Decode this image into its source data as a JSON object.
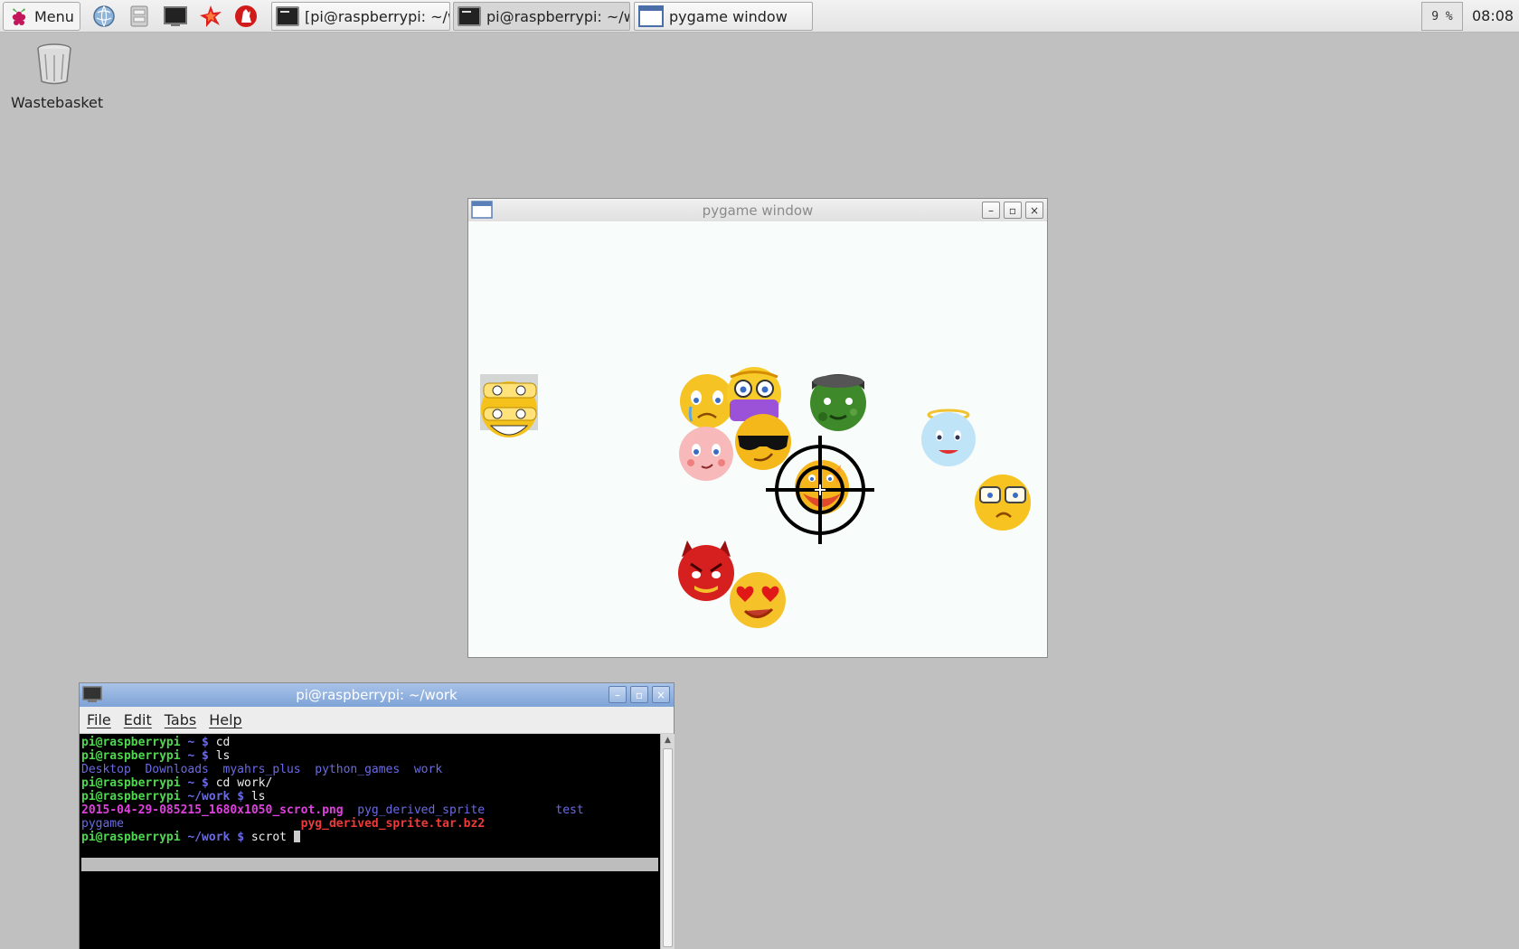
{
  "taskbar": {
    "menu_label": "Menu",
    "launchers": [
      "web-browser-icon",
      "file-manager-icon",
      "terminal-icon",
      "mathematica-icon",
      "wolfram-icon"
    ],
    "tasks": [
      {
        "label": "[pi@raspberrypi: ~/w...",
        "icon": "terminal-icon"
      },
      {
        "label": "pi@raspberrypi: ~/w...",
        "icon": "terminal-icon"
      },
      {
        "label": "pygame window",
        "icon": "window-icon"
      }
    ],
    "cpu_label": "9 %",
    "clock": "08:08"
  },
  "desktop": {
    "wastebasket_label": "Wastebasket"
  },
  "pygame_window": {
    "title": "pygame window",
    "sprites": [
      "grinning-masked-emoji",
      "sad-emoji",
      "nerd-emoji-purple",
      "soldier-emoji-green",
      "angel-emoji",
      "blushing-emoji",
      "cool-sunglasses-emoji",
      "crosshair-target-emoji",
      "worried-glasses-emoji",
      "devil-emoji",
      "heart-eyes-emoji"
    ]
  },
  "terminal_window": {
    "title": "pi@raspberrypi: ~/work",
    "menu": [
      "File",
      "Edit",
      "Tabs",
      "Help"
    ],
    "lines": {
      "l1_prompt": "pi@raspberrypi",
      "l1_path": " ~ $",
      "l1_cmd": " cd",
      "l2_prompt": "pi@raspberrypi",
      "l2_path": " ~ $",
      "l2_cmd": " ls",
      "l3_dirs": "Desktop  Downloads  myahrs_plus  python_games  work",
      "l4_prompt": "pi@raspberrypi",
      "l4_path": " ~ $",
      "l4_cmd": " cd work/",
      "l5_prompt": "pi@raspberrypi",
      "l5_path": " ~/work $",
      "l5_cmd": " ls",
      "l6_png": "2015-04-29-085215_1680x1050_scrot.png",
      "l6_dir1": "  pyg_derived_sprite",
      "l6_dir2": "          test",
      "l7_dir": "pygame",
      "l7_tar": "                         pyg_derived_sprite.tar.bz2",
      "l8_prompt": "pi@raspberrypi",
      "l8_path": " ~/work $",
      "l8_cmd": " scrot "
    }
  }
}
